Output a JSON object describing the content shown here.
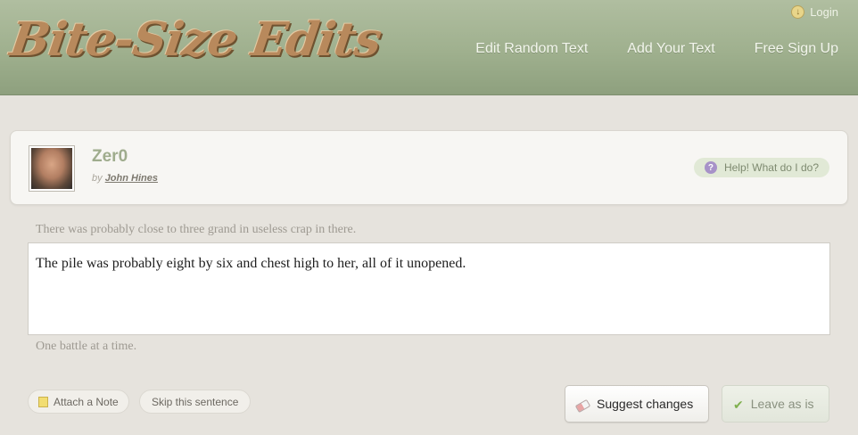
{
  "header": {
    "logo_text": "Bite-Size Edits",
    "login_label": "Login",
    "nav": [
      {
        "label": "Edit Random Text"
      },
      {
        "label": "Add Your Text"
      },
      {
        "label": "Free Sign Up"
      }
    ]
  },
  "card": {
    "title": "Zer0",
    "by_label": "by",
    "author": "John Hines",
    "help_label": "Help! What do I do?"
  },
  "sentences": {
    "before": "There was probably close to three grand in useless crap in there.",
    "current": "The pile was probably eight by six and chest high to her, all of it unopened.",
    "after": "One battle at a time."
  },
  "actions": {
    "attach_note": "Attach a Note",
    "skip": "Skip this sentence",
    "suggest": "Suggest changes",
    "leave": "Leave as is"
  },
  "icons": {
    "login": "download-circle-icon",
    "help": "question-icon",
    "note": "sticky-note-icon",
    "suggest": "eraser-icon",
    "leave": "check-icon"
  }
}
